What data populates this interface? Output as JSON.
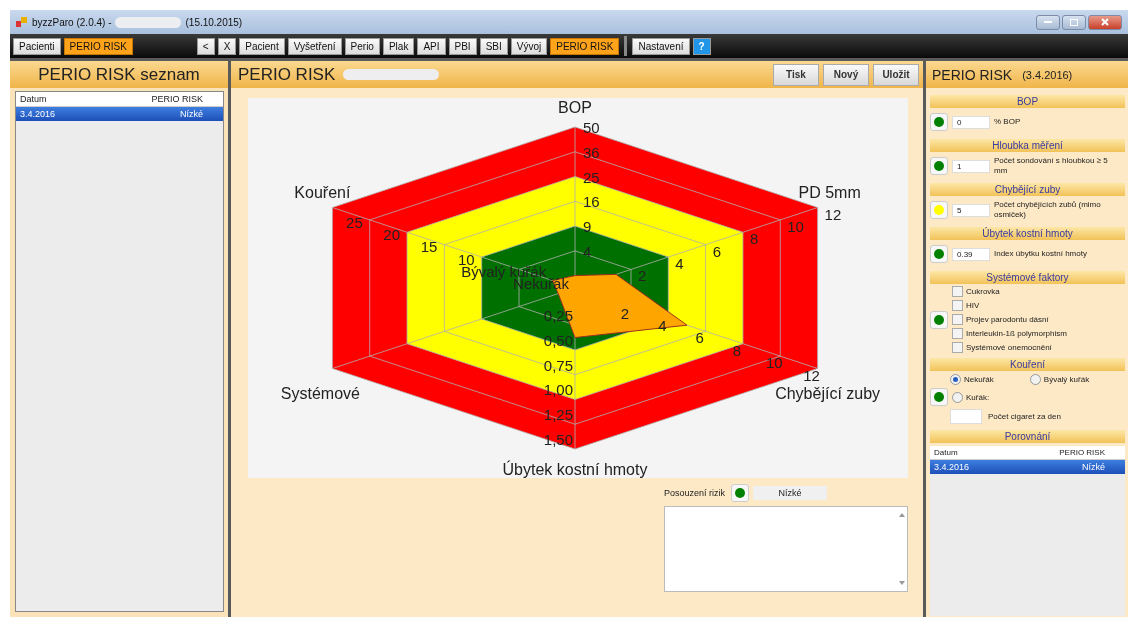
{
  "window": {
    "title": "byzzParo (2.0.4) -",
    "date": "(15.10.2015)"
  },
  "toolbar": {
    "left": [
      {
        "label": "Pacienti",
        "selected": false
      },
      {
        "label": "PERIO RISK",
        "selected": true
      }
    ],
    "nav": [
      "<",
      "X"
    ],
    "modules": [
      {
        "label": "Pacient",
        "selected": false
      },
      {
        "label": "Vyšetření",
        "selected": false
      },
      {
        "label": "Perio",
        "selected": false
      },
      {
        "label": "Plak",
        "selected": false
      },
      {
        "label": "API",
        "selected": false
      },
      {
        "label": "PBI",
        "selected": false
      },
      {
        "label": "SBI",
        "selected": false
      },
      {
        "label": "Vývoj",
        "selected": false
      },
      {
        "label": "PERIO RISK",
        "selected": true
      }
    ],
    "settings": "Nastavení",
    "help": "?"
  },
  "list_panel": {
    "title": "PERIO RISK seznam",
    "columns": [
      "Datum",
      "PERIO RISK"
    ],
    "rows": [
      {
        "cells": [
          "3.4.2016",
          "Nízké"
        ],
        "selected": true
      }
    ]
  },
  "main": {
    "title": "PERIO RISK",
    "actions": [
      "Tisk",
      "Nový",
      "Uložit"
    ],
    "radar": {
      "axes": [
        {
          "label": "BOP",
          "ticks": [
            "50",
            "36",
            "25",
            "16",
            "9",
            "4"
          ]
        },
        {
          "label": "Kouření",
          "ticks": [
            "25",
            "20",
            "15",
            "10",
            "Bývalý kuřák",
            "Nekuřák"
          ]
        },
        {
          "label": "PD 5mm",
          "ticks": [
            "12",
            "10",
            "8",
            "6",
            "4",
            "2"
          ]
        },
        {
          "label": "Systémové"
        },
        {
          "label": "Chybějící zuby",
          "ticks": [
            "2",
            "4",
            "6",
            "8",
            "10",
            "12"
          ]
        },
        {
          "label": "Úbytek kostní hmoty",
          "ticks": [
            "0,25",
            "0,50",
            "0,75",
            "1,00",
            "1,25",
            "1,50"
          ]
        }
      ]
    },
    "assessment": {
      "label": "Posouzení rizik",
      "color": "#008000",
      "value": "Nízké"
    }
  },
  "detail": {
    "title": "PERIO RISK",
    "date": "(3.4.2016)",
    "sections": [
      {
        "kind": "value",
        "title": "BOP",
        "color": "#008000",
        "value": "0",
        "label": "% BOP"
      },
      {
        "kind": "value",
        "title": "Hloubka měření",
        "color": "#008000",
        "value": "1",
        "label": "Počet sondování s hloubkou ≥ 5 mm"
      },
      {
        "kind": "value",
        "title": "Chybějící zuby",
        "color": "#ffff00",
        "value": "5",
        "label": "Počet chybějících zubů (mimo osmiček)"
      },
      {
        "kind": "value",
        "title": "Úbytek kostní hmoty",
        "color": "#008000",
        "value": "0.39",
        "label": "Index úbytku kostní hmoty"
      },
      {
        "kind": "checks",
        "title": "Systémové faktory",
        "color": "#008000",
        "items": [
          {
            "label": "Cukrovka",
            "checked": false
          },
          {
            "label": "HIV",
            "checked": false
          },
          {
            "label": "Projev parodontu dásní",
            "checked": false
          },
          {
            "label": "Interleukin-1ß polymorphism",
            "checked": false
          },
          {
            "label": "Systémové onemocnění",
            "checked": false
          }
        ]
      },
      {
        "kind": "smoking",
        "title": "Kouření",
        "color": "#008000",
        "options": [
          {
            "label": "Nekuřák",
            "selected": true
          },
          {
            "label": "Bývalý kuřák",
            "selected": false
          },
          {
            "label": "Kuřák:",
            "selected": false
          }
        ],
        "count_label": "Počet cigaret za den"
      },
      {
        "kind": "table",
        "title": "Porovnání",
        "columns": [
          "Datum",
          "PERIO RISK"
        ],
        "rows": [
          {
            "cells": [
              "3.4.2016",
              "Nízké"
            ],
            "selected": true
          }
        ]
      }
    ]
  }
}
